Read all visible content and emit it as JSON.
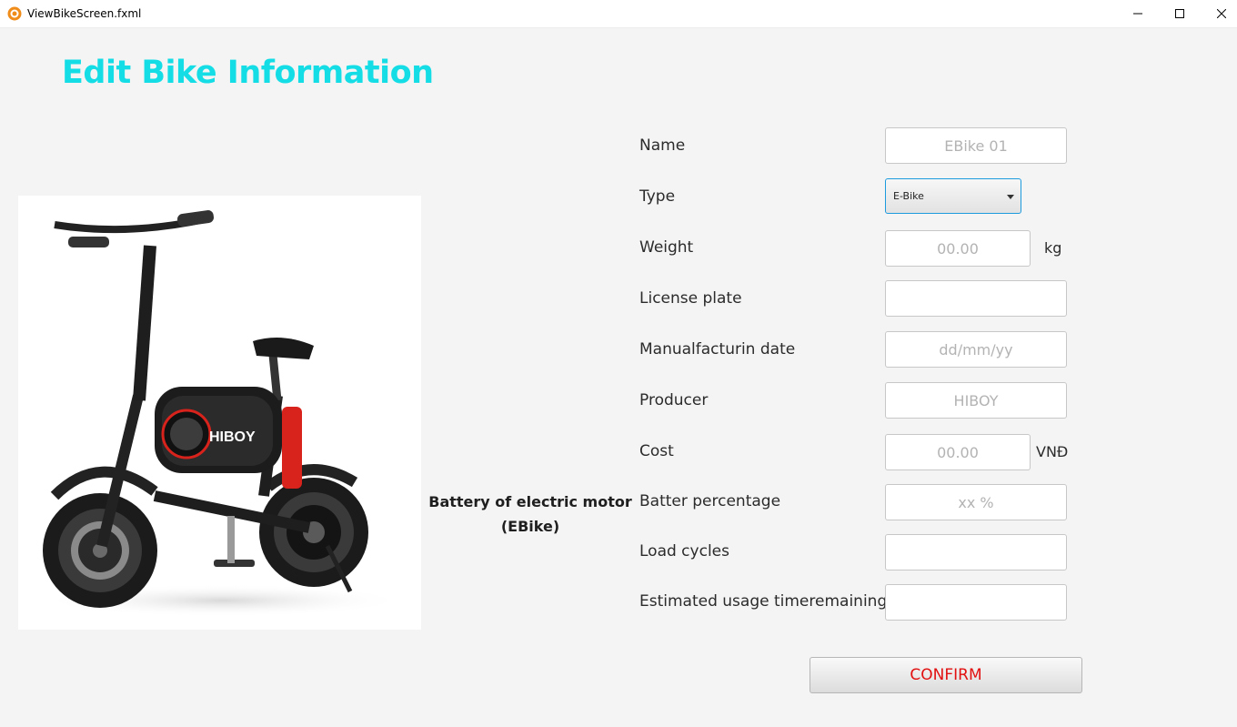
{
  "window": {
    "title": "ViewBikeScreen.fxml",
    "icons": [
      "app-icon",
      "minimize-icon",
      "maximize-icon",
      "close-icon"
    ]
  },
  "page": {
    "title": "Edit Bike Information",
    "section_label_line1": "Battery of electric motor",
    "section_label_line2": "(EBike)"
  },
  "form": {
    "name": {
      "label": "Name",
      "value": "",
      "placeholder": "EBike 01"
    },
    "type": {
      "label": "Type",
      "selected": "E-Bike"
    },
    "weight": {
      "label": "Weight",
      "value": "",
      "placeholder": "00.00",
      "unit": "kg"
    },
    "license_plate": {
      "label": "License plate",
      "value": "",
      "placeholder": ""
    },
    "manufacturing_date": {
      "label": "Manualfacturin date",
      "value": "",
      "placeholder": "dd/mm/yy"
    },
    "producer": {
      "label": "Producer",
      "value": "",
      "placeholder": "HIBOY"
    },
    "cost": {
      "label": "Cost",
      "value": "",
      "placeholder": "00.00",
      "unit": "VNĐ"
    },
    "battery_percentage": {
      "label": "Batter percentage",
      "value": "",
      "placeholder": "xx %"
    },
    "load_cycles": {
      "label": "Load cycles",
      "value": "",
      "placeholder": ""
    },
    "estimated_usage_time": {
      "label": "Estimated usage timeremaining",
      "value": "",
      "placeholder": ""
    }
  },
  "actions": {
    "confirm_label": "CONFIRM"
  },
  "image": {
    "brand_text": "HIBOY"
  },
  "colors": {
    "title": "#14dde6",
    "confirm_text": "#e21010",
    "focus_border": "#1d9bdf",
    "battery_accent": "#d8231c"
  }
}
